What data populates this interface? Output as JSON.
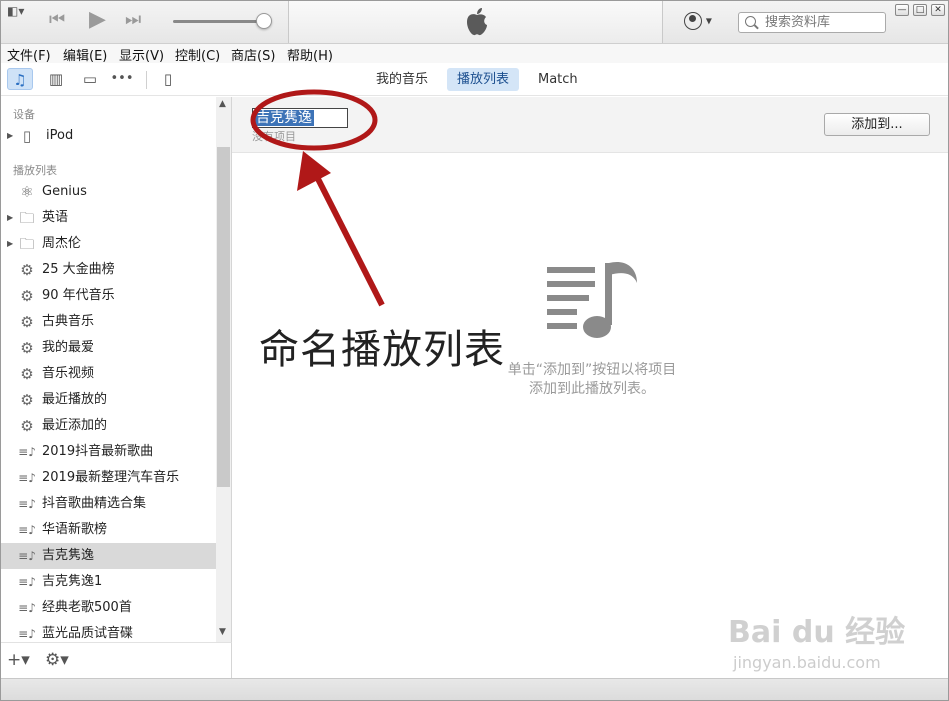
{
  "titlebar": {
    "search_placeholder": "搜索资料库",
    "window_buttons": [
      "—",
      "□",
      "✕"
    ]
  },
  "menu": [
    "文件(F)",
    "编辑(E)",
    "显示(V)",
    "控制(C)",
    "商店(S)",
    "帮助(H)"
  ],
  "tabs": [
    {
      "label": "我的音乐",
      "active": false
    },
    {
      "label": "播放列表",
      "active": true
    },
    {
      "label": "Match",
      "active": false
    }
  ],
  "sidebar": {
    "devices_header": "设备",
    "device": "iPod",
    "playlists_header": "播放列表",
    "items": [
      {
        "label": "Genius",
        "icon": "genius-icon"
      },
      {
        "label": "英语",
        "icon": "folder-icon",
        "expandable": true
      },
      {
        "label": "周杰伦",
        "icon": "folder-icon",
        "expandable": true
      },
      {
        "label": "25 大金曲榜",
        "icon": "smart-playlist-gear-icon"
      },
      {
        "label": "90 年代音乐",
        "icon": "smart-playlist-gear-icon"
      },
      {
        "label": "古典音乐",
        "icon": "smart-playlist-gear-icon"
      },
      {
        "label": "我的最爱",
        "icon": "smart-playlist-gear-icon"
      },
      {
        "label": "音乐视频",
        "icon": "smart-playlist-gear-icon"
      },
      {
        "label": "最近播放的",
        "icon": "smart-playlist-gear-icon"
      },
      {
        "label": "最近添加的",
        "icon": "smart-playlist-gear-icon"
      },
      {
        "label": "2019抖音最新歌曲",
        "icon": "playlist-icon"
      },
      {
        "label": "2019最新整理汽车音乐",
        "icon": "playlist-icon"
      },
      {
        "label": "抖音歌曲精选合集",
        "icon": "playlist-icon"
      },
      {
        "label": "华语新歌榜",
        "icon": "playlist-icon"
      },
      {
        "label": "吉克隽逸",
        "icon": "playlist-icon",
        "selected": true
      },
      {
        "label": "吉克隽逸1",
        "icon": "playlist-icon"
      },
      {
        "label": "经典老歌500首",
        "icon": "playlist-icon"
      },
      {
        "label": "蓝光品质试音碟",
        "icon": "playlist-icon"
      }
    ]
  },
  "main": {
    "playlist_name": "吉克隽逸",
    "no_items": "没有项目",
    "add_to_button": "添加到...",
    "empty_line1": "单击“添加到”按钮以将项目",
    "empty_line2": "添加到此播放列表。"
  },
  "annotation": {
    "text": "命名播放列表",
    "color": "#b01818"
  },
  "watermark": {
    "main": "Bai du 经验",
    "sub": "jingyan.baidu.com"
  }
}
